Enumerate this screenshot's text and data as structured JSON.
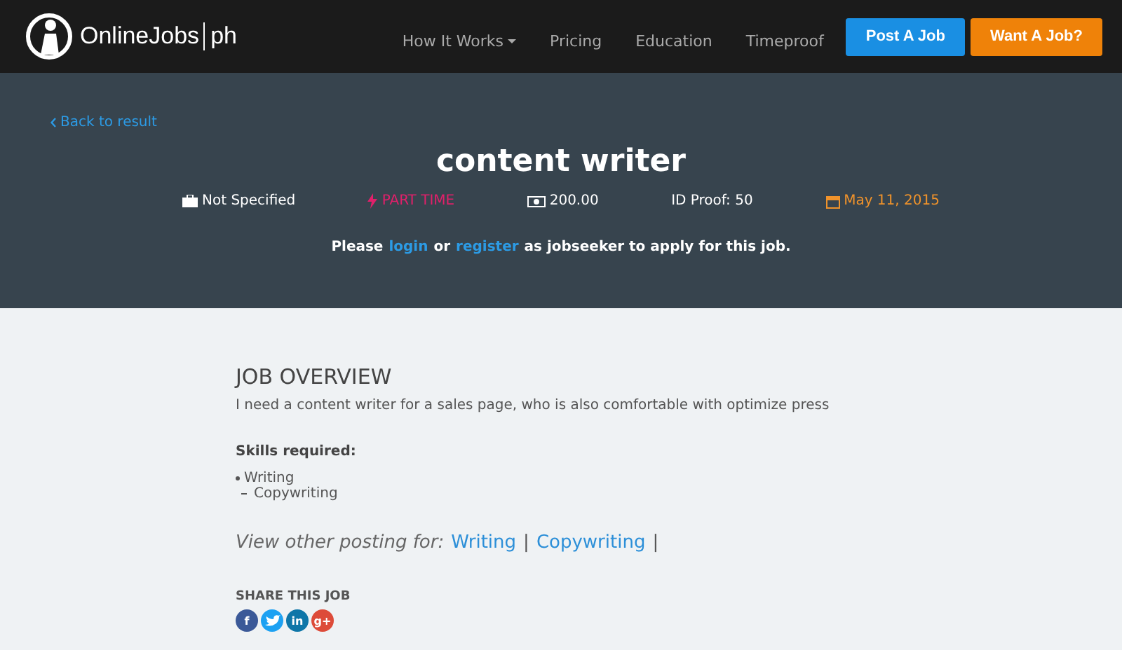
{
  "header": {
    "logo": {
      "name": "OnlineJobs",
      "suffix": "ph"
    },
    "nav": [
      {
        "label": "How It Works",
        "dropdown": true
      },
      {
        "label": "Pricing",
        "dropdown": false
      },
      {
        "label": "Education",
        "dropdown": false
      },
      {
        "label": "Timeproof",
        "dropdown": false
      }
    ],
    "buttons": [
      {
        "label": "Post A Job",
        "kind": "primary"
      },
      {
        "label": "Want A Job?",
        "kind": "warning"
      }
    ]
  },
  "hero": {
    "back_link": "Back to result",
    "title": "content writer",
    "meta": [
      {
        "kind": "briefcase",
        "text": "Not Specified"
      },
      {
        "kind": "bolt",
        "text": "PART TIME"
      },
      {
        "kind": "money",
        "text": "200.00"
      },
      {
        "kind": "plain",
        "text": "ID Proof: 50"
      },
      {
        "kind": "calendar",
        "text": "May 11, 2015"
      }
    ],
    "apply": {
      "before": "Please",
      "login": "login",
      "middle": "or",
      "register": "register",
      "after": "as jobseeker to apply for this job."
    }
  },
  "overview": {
    "heading": "JOB OVERVIEW",
    "description": "I need a content writer for a sales page, who is also comfortable with optimize press",
    "skills_label": "Skills required:",
    "skills": [
      {
        "label": "Writing",
        "children": [
          {
            "label": "Copywriting"
          }
        ]
      }
    ],
    "other_label": "View other posting for:",
    "other_links": [
      "Writing",
      "Copywriting"
    ],
    "separator": "|",
    "share_label": "SHARE THIS JOB",
    "share": [
      {
        "kind": "facebook",
        "glyph": "f"
      },
      {
        "kind": "twitter"
      },
      {
        "kind": "linkedin",
        "glyph": "in"
      },
      {
        "kind": "google",
        "glyph": "g+"
      }
    ]
  }
}
